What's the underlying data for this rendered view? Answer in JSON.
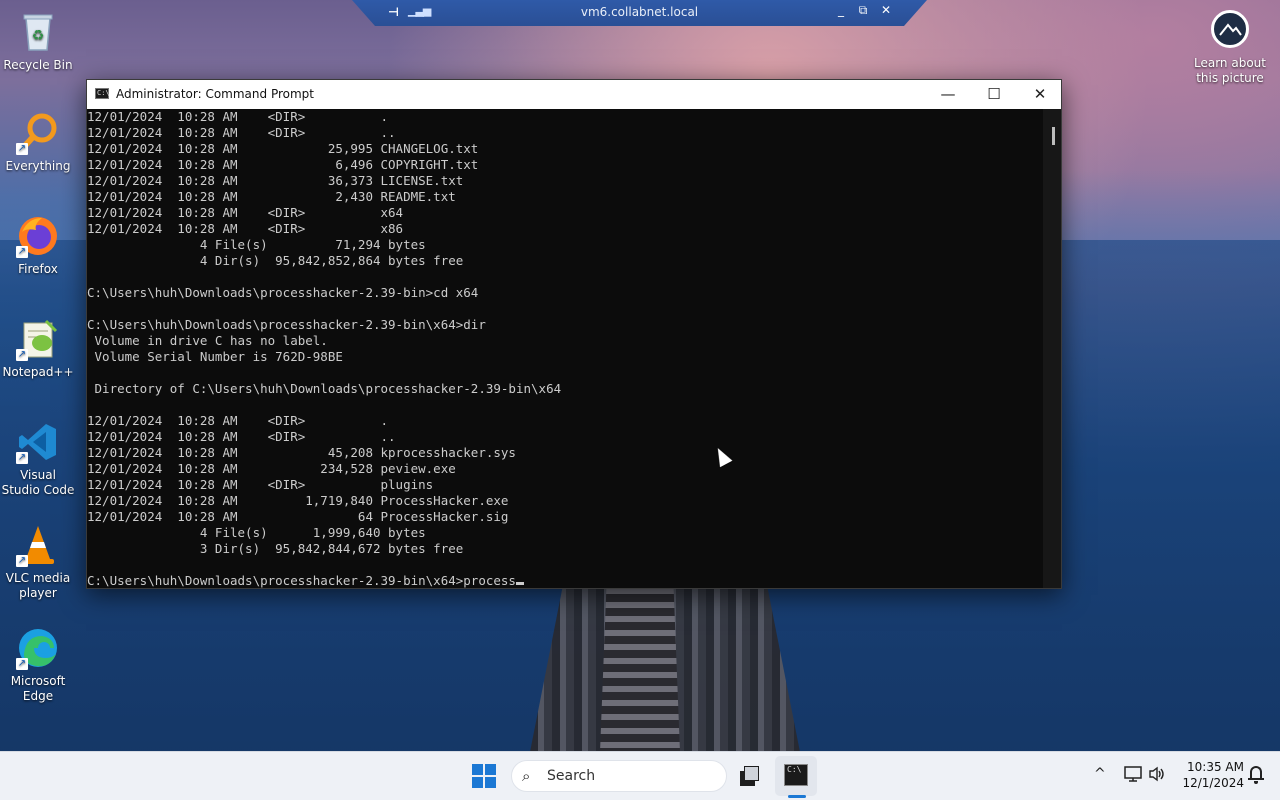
{
  "rdp": {
    "host": "vm6.collabnet.local",
    "pin_icon": "pin-icon",
    "minimize": "_",
    "restore": "⧉",
    "close": "✕"
  },
  "desktop": {
    "icons": [
      {
        "label": "Recycle Bin",
        "icon": "recycle-bin-icon"
      },
      {
        "label": "Everything",
        "icon": "everything-search-icon"
      },
      {
        "label": "Firefox",
        "icon": "firefox-icon"
      },
      {
        "label": "Notepad++",
        "icon": "notepadpp-icon"
      },
      {
        "label": "Visual Studio Code",
        "icon": "vscode-icon"
      },
      {
        "label": "VLC media player",
        "icon": "vlc-icon"
      },
      {
        "label": "Microsoft Edge",
        "icon": "edge-icon"
      }
    ],
    "learn_about": "Learn about this picture"
  },
  "window": {
    "title": "Administrator: Command Prompt",
    "icon_text": "C:\\",
    "minimize": "—",
    "maximize": "☐",
    "close": "✕"
  },
  "console": {
    "lines": [
      "12/01/2024  10:28 AM    <DIR>          .",
      "12/01/2024  10:28 AM    <DIR>          ..",
      "12/01/2024  10:28 AM            25,995 CHANGELOG.txt",
      "12/01/2024  10:28 AM             6,496 COPYRIGHT.txt",
      "12/01/2024  10:28 AM            36,373 LICENSE.txt",
      "12/01/2024  10:28 AM             2,430 README.txt",
      "12/01/2024  10:28 AM    <DIR>          x64",
      "12/01/2024  10:28 AM    <DIR>          x86",
      "               4 File(s)         71,294 bytes",
      "               4 Dir(s)  95,842,852,864 bytes free",
      "",
      "C:\\Users\\huh\\Downloads\\processhacker-2.39-bin>cd x64",
      "",
      "C:\\Users\\huh\\Downloads\\processhacker-2.39-bin\\x64>dir",
      " Volume in drive C has no label.",
      " Volume Serial Number is 762D-98BE",
      "",
      " Directory of C:\\Users\\huh\\Downloads\\processhacker-2.39-bin\\x64",
      "",
      "12/01/2024  10:28 AM    <DIR>          .",
      "12/01/2024  10:28 AM    <DIR>          ..",
      "12/01/2024  10:28 AM            45,208 kprocesshacker.sys",
      "12/01/2024  10:28 AM           234,528 peview.exe",
      "12/01/2024  10:28 AM    <DIR>          plugins",
      "12/01/2024  10:28 AM         1,719,840 ProcessHacker.exe",
      "12/01/2024  10:28 AM                64 ProcessHacker.sig",
      "               4 File(s)      1,999,640 bytes",
      "               3 Dir(s)  95,842,844,672 bytes free",
      ""
    ],
    "prompt": "C:\\Users\\huh\\Downloads\\processhacker-2.39-bin\\x64>process"
  },
  "taskbar": {
    "search_label": "Search",
    "time": "10:35 AM",
    "date": "12/1/2024",
    "tray_chevron": "^"
  }
}
